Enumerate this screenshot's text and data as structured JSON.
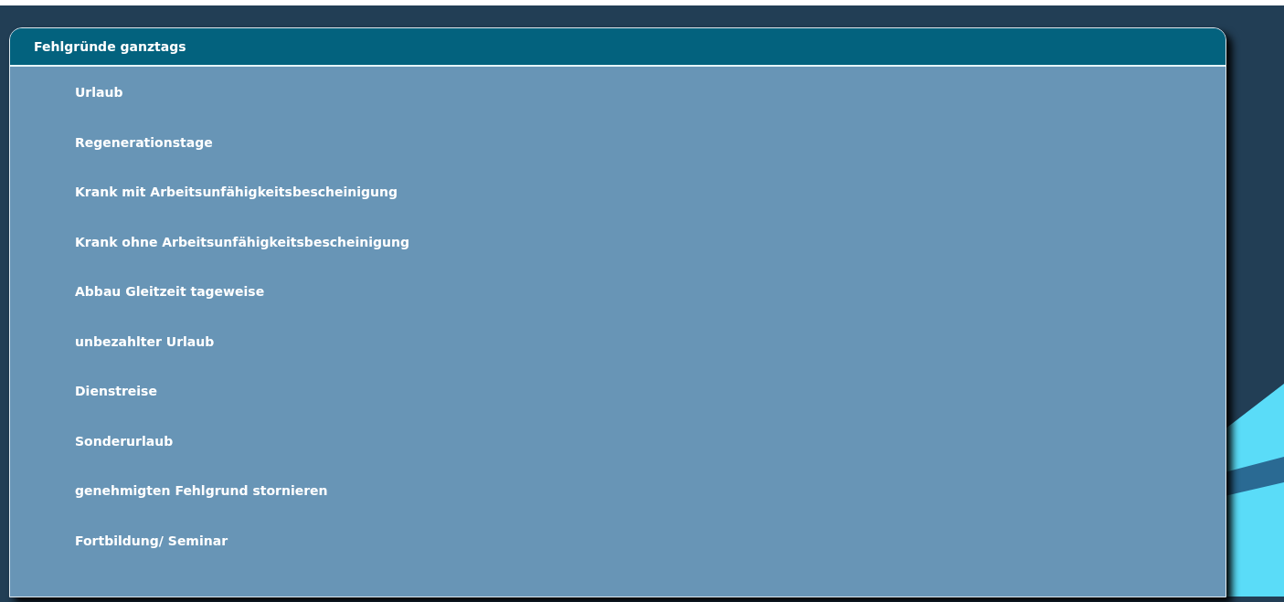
{
  "panel": {
    "title": "Fehlgründe ganztags",
    "items": [
      {
        "label": "Urlaub"
      },
      {
        "label": "Regenerationstage"
      },
      {
        "label": "Krank mit Arbeitsunfähigkeitsbescheinigung"
      },
      {
        "label": "Krank ohne Arbeitsunfähigkeitsbescheinigung"
      },
      {
        "label": "Abbau Gleitzeit tageweise"
      },
      {
        "label": "unbezahlter Urlaub"
      },
      {
        "label": "Dienstreise"
      },
      {
        "label": "Sonderurlaub"
      },
      {
        "label": "genehmigten Fehlgrund stornieren"
      },
      {
        "label": "Fortbildung/ Seminar"
      }
    ]
  }
}
